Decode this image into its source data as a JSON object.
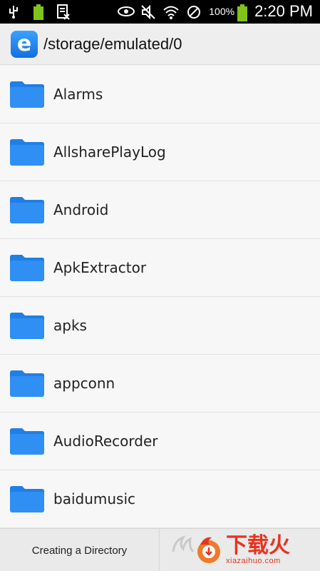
{
  "status_bar": {
    "battery_percent": "100%",
    "time": "2:20 PM",
    "left_icons": [
      "usb-icon",
      "battery-small-icon",
      "screenshot-icon"
    ],
    "right_icons": [
      "eye-icon",
      "mute-icon",
      "wifi-icon",
      "block-icon",
      "battery-icon"
    ]
  },
  "app_bar": {
    "logo_letter": "e",
    "path": "/storage/emulated/0"
  },
  "files": [
    {
      "label": "Alarms"
    },
    {
      "label": "AllsharePlayLog"
    },
    {
      "label": "Android"
    },
    {
      "label": "ApkExtractor"
    },
    {
      "label": "apks"
    },
    {
      "label": "appconn"
    },
    {
      "label": "AudioRecorder"
    },
    {
      "label": "baidumusic"
    }
  ],
  "bottom_bar": {
    "create_label": "Creating a Directory"
  },
  "watermark": {
    "cn": "下载火",
    "en": "xiazaihuo.com"
  },
  "colors": {
    "accent": "#1a84f0",
    "folder": "#2f8ff2",
    "watermark": "#e8331f"
  }
}
